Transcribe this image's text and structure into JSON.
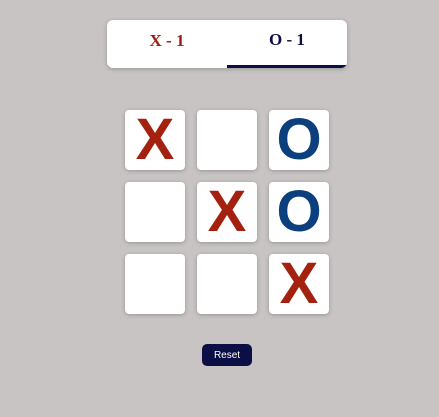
{
  "scoreboard": {
    "x_score": "X - 1",
    "o_score": "O - 1",
    "active_player": "O"
  },
  "board": {
    "cells": [
      "X",
      "",
      "O",
      "",
      "X",
      "O",
      "",
      "",
      "X"
    ]
  },
  "controls": {
    "reset_label": "Reset"
  },
  "colors": {
    "background": "#c8c4c4",
    "x_mark": "#a4200f",
    "o_mark": "#0c3f7d",
    "accent": "#0b0f45"
  }
}
